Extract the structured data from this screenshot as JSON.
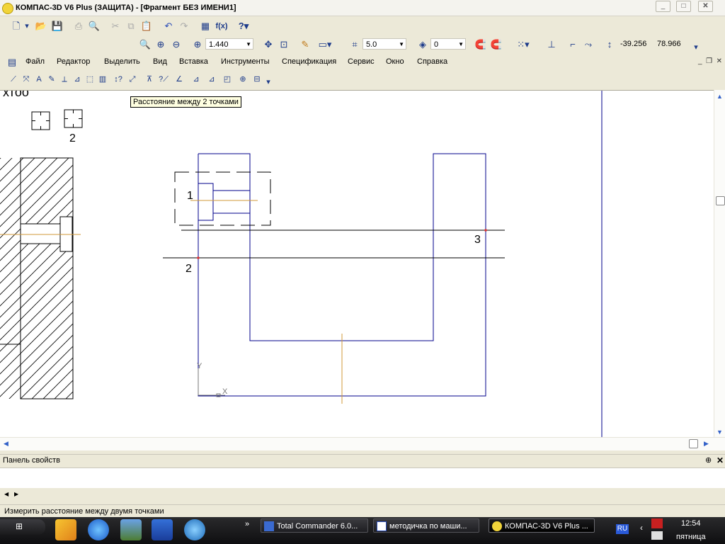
{
  "window": {
    "title": "КОМПАС-3D V6 Plus (ЗАЩИТА) - [Фрагмент БЕЗ ИМЕНИ1]",
    "controls": [
      "minimize",
      "maximize",
      "close"
    ]
  },
  "toolbar1": {
    "zoom_value": "1.440",
    "step_value": "5.0",
    "layer_value": "0",
    "coord_x": "-39.256",
    "coord_y": "78.966",
    "fx_label": "f(x)"
  },
  "menu": {
    "items": [
      "Файл",
      "Редактор",
      "Выделить",
      "Вид",
      "Вставка",
      "Инструменты",
      "Спецификация",
      "Сервис",
      "Окно",
      "Справка"
    ]
  },
  "tooltip": "Расстояние между 2 точками",
  "drawing": {
    "fragment_text": "хтоо",
    "label_top2": "2",
    "point1": "1",
    "point2": "2",
    "point3": "3",
    "axis_y": "Y",
    "axis_x": "X"
  },
  "property_panel": {
    "title": "Панель свойств",
    "pin": "⊕",
    "close": "✕"
  },
  "status": "Измерить расстояние между двумя точками",
  "taskbar": {
    "tasks": [
      {
        "label": "Total Commander 6.0...",
        "icon": "floppy-icon"
      },
      {
        "label": "методичка по маши...",
        "icon": "word-icon"
      },
      {
        "label": "КОМПАС-3D V6 Plus ...",
        "icon": "kompas-icon"
      }
    ],
    "lang": "RU",
    "time": "12:54",
    "day": "пятница",
    "more": "»"
  },
  "colors": {
    "geometry": "#00008b",
    "axis_line": "#d29a3a",
    "aux_line": "#000000",
    "accent": "#1d3b8a"
  }
}
